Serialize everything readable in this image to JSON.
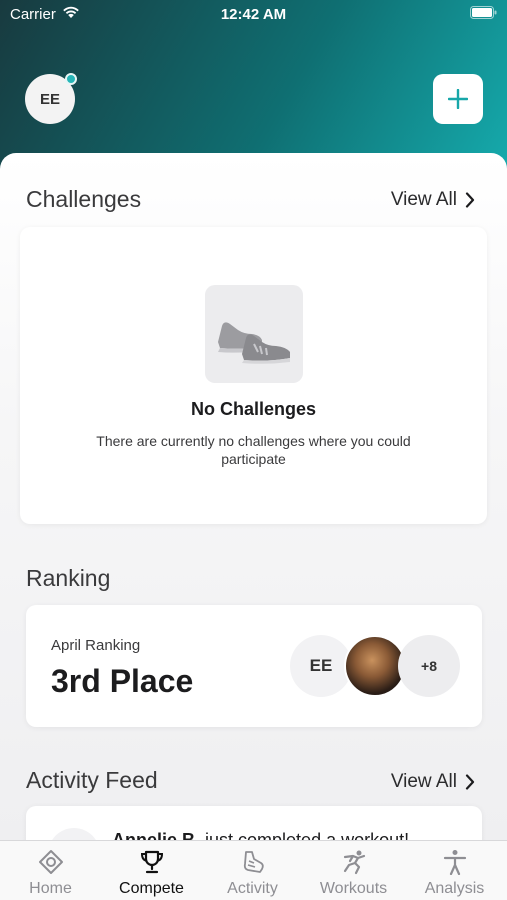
{
  "status_bar": {
    "carrier": "Carrier",
    "time": "12:42 AM"
  },
  "header": {
    "avatar_initials": "EE"
  },
  "challenges": {
    "title": "Challenges",
    "view_all": "View All",
    "empty_title": "No Challenges",
    "empty_description": "There are currently no challenges where you could participate"
  },
  "ranking": {
    "title": "Ranking",
    "label": "April Ranking",
    "value": "3rd Place",
    "participants": {
      "first_initials": "EE",
      "more_count": "+8"
    }
  },
  "activity_feed": {
    "title": "Activity Feed",
    "view_all": "View All",
    "items": [
      {
        "name": "Annelie B.",
        "text": " just completed a workout!"
      }
    ]
  },
  "tabs": [
    {
      "label": "Home",
      "icon": "home-icon"
    },
    {
      "label": "Compete",
      "icon": "trophy-icon"
    },
    {
      "label": "Activity",
      "icon": "activity-icon"
    },
    {
      "label": "Workouts",
      "icon": "workouts-icon"
    },
    {
      "label": "Analysis",
      "icon": "analysis-icon"
    }
  ],
  "colors": {
    "accent": "#16aeb0",
    "hero_dark": "#183a3f",
    "online": "#27b6b8"
  }
}
